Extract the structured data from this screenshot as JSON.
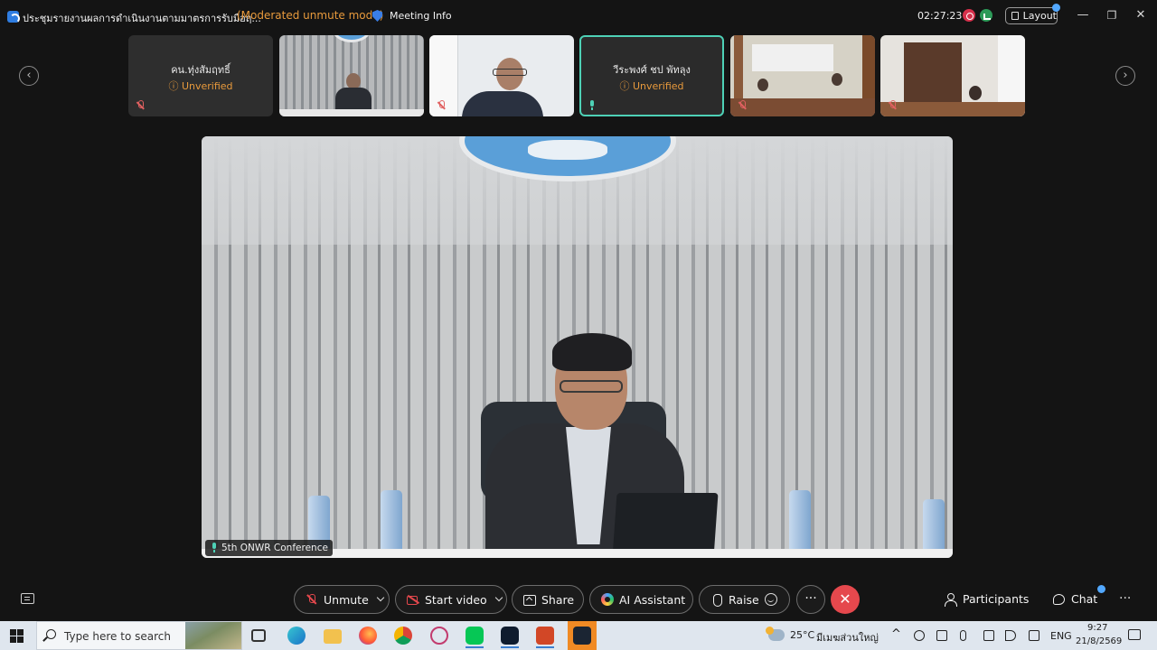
{
  "titlebar": {
    "title": "ประชุมรายงานผลการดำเนินงานตามมาตรการรับมือฤ...",
    "mode": "(Moderated unmute mode)",
    "meeting_info": "Meeting Info",
    "timer": "02:27:23",
    "layout_label": "Layout",
    "minimize": "—",
    "restore": "❐",
    "close": "✕"
  },
  "strip": {
    "prev": "‹",
    "next": "›",
    "participants": [
      {
        "name": "คน.ทุ่งสัมฤทธิ์",
        "status": "Unverified",
        "mic": "muted",
        "video": false
      },
      {
        "name": "",
        "status": "",
        "mic": "none",
        "video": true,
        "scene": "lobby"
      },
      {
        "name": "",
        "status": "",
        "mic": "muted",
        "video": true,
        "scene": "office"
      },
      {
        "name": "วีระพงศ์ ชป พัทลุง",
        "status": "Unverified",
        "mic": "on",
        "video": false,
        "active": true
      },
      {
        "name": "",
        "status": "",
        "mic": "muted",
        "video": true,
        "scene": "meeting-room"
      },
      {
        "name": "",
        "status": "",
        "mic": "muted",
        "video": true,
        "scene": "library-room"
      }
    ]
  },
  "main_video": {
    "speaker_label": "5th ONWR Conference"
  },
  "controls": {
    "unmute": "Unmute",
    "start_video": "Start video",
    "share": "Share",
    "ai_assistant": "AI Assistant",
    "raise": "Raise",
    "more": "···",
    "end": "✕",
    "participants": "Participants",
    "chat": "Chat",
    "overflow": "···"
  },
  "taskbar": {
    "search_placeholder": "Type here to search",
    "temperature": "25°C",
    "weather_text": "มีเมฆส่วนใหญ่",
    "language": "ENG",
    "time": "9:27",
    "date": "21/8/2569",
    "pinned_apps": [
      "task-view",
      "edge",
      "file-explorer",
      "firefox",
      "chrome",
      "snipping-tool",
      "line",
      "webex",
      "powerpoint",
      "webex-meetings"
    ]
  },
  "colors": {
    "accent_orange": "#e89a3c",
    "active_border": "#4ed1b6",
    "end_red": "#e5484d",
    "muted_red": "#e06060"
  }
}
